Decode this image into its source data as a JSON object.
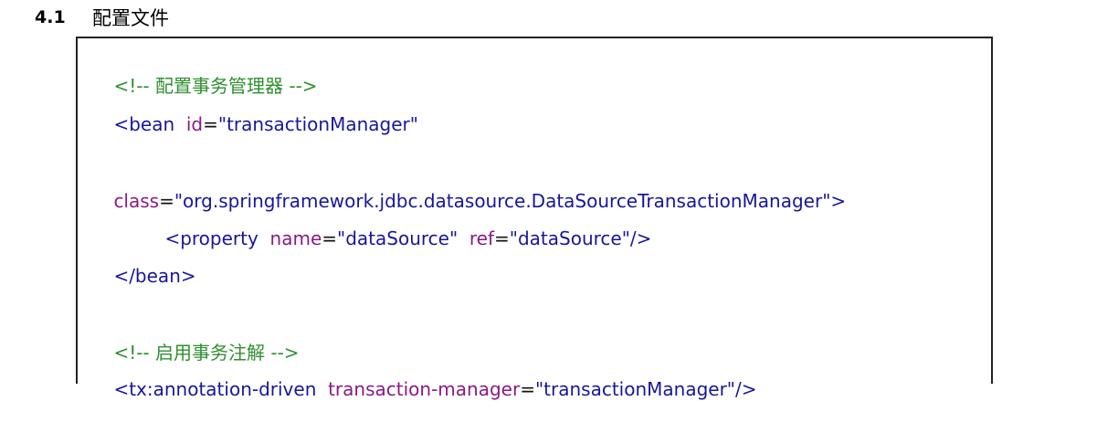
{
  "section": {
    "number": "4.1",
    "title": "配置文件"
  },
  "code": {
    "comment_tx_manager": "<!-- 配置事务管理器 -->",
    "bean_open": "<bean",
    "bean_id_attr": "id",
    "bean_id_value": "\"transactionManager\"",
    "bean_class_attr": "class",
    "bean_class_value": "\"org.springframework.jdbc.datasource.DataSourceTransactionManager\"",
    "bean_close_bracket": ">",
    "property_open": "<property",
    "property_name_attr": "name",
    "property_name_value": "\"dataSource\"",
    "property_ref_attr": "ref",
    "property_ref_value": "\"dataSource\"",
    "property_close": "/>",
    "bean_end": "</bean>",
    "comment_annotation": "<!-- 启用事务注解 -->",
    "tx_open": "<tx:annotation-driven",
    "tx_attr": "transaction-manager",
    "tx_value": "\"transactionManager\"",
    "tx_close": "/>",
    "equals": "="
  },
  "colors": {
    "comment": "#2f8f2f",
    "tag": "#17179a",
    "attribute": "#8a1a86"
  }
}
